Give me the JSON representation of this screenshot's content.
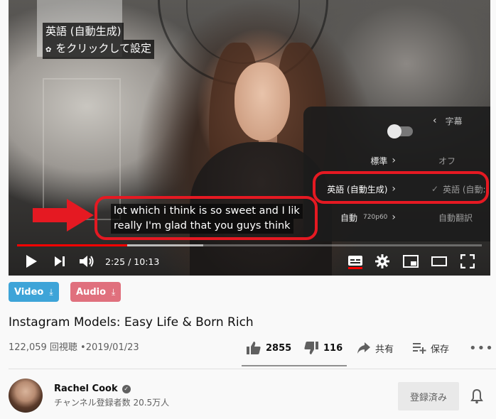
{
  "player": {
    "caption_hint": {
      "line1": "英語 (自動生成)",
      "line2": "をクリックして設定"
    },
    "subtitles": {
      "line1": "lot which i think is so sweet and I lik",
      "line2": "really I'm glad that you guys think"
    },
    "settings_menu": {
      "captions_title": "字幕",
      "rows": [
        {
          "left": "標準",
          "right": "オフ"
        },
        {
          "left": "英語 (自動生成)",
          "right": "英語 (自動:"
        },
        {
          "left": "自動",
          "left_small": "720p60",
          "right": "自動翻訳"
        }
      ]
    },
    "time": {
      "current": "2:25",
      "separator": "/",
      "duration": "10:13"
    },
    "progress": {
      "played_fraction": 0.237,
      "loaded_fraction": 0.4
    },
    "icons": [
      "play-icon",
      "next-icon",
      "volume-icon",
      "subtitles-icon",
      "settings-gear-icon",
      "miniplayer-icon",
      "theater-icon",
      "fullscreen-icon"
    ]
  },
  "downloads": {
    "video_label": "Video",
    "audio_label": "Audio",
    "video_color": "#3ea4d8",
    "audio_color": "#e0707d"
  },
  "video": {
    "title": "Instagram Models: Easy Life & Born Rich",
    "views": "122,059 回視聴",
    "separator": "•",
    "date": "2019/01/23"
  },
  "actions": {
    "likes": "2855",
    "dislikes": "116",
    "share": "共有",
    "save": "保存",
    "like_fraction": 0.961
  },
  "channel": {
    "name": "Rachel Cook",
    "subscribers": "チャンネル登録者数 20.5万人",
    "subscribe_label": "登録済み"
  },
  "accent": {
    "annotation_red": "#e51922",
    "progress_red": "#ff0000"
  }
}
